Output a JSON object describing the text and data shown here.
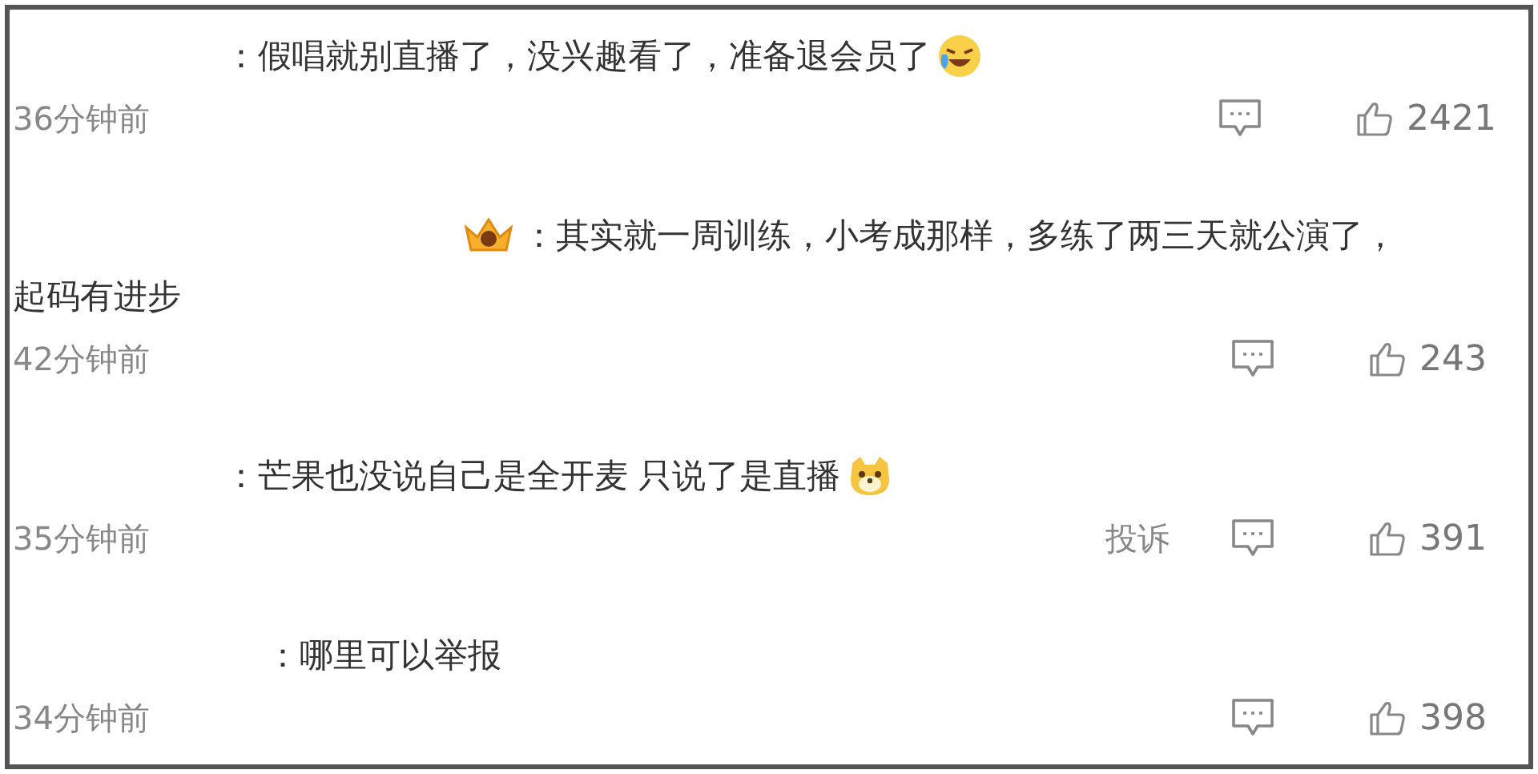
{
  "comments": [
    {
      "lines": [
        "：假唱就别直播了，没兴趣看了，准备退会员了"
      ],
      "badge": false,
      "emoji": {
        "kind": "laughing"
      },
      "time": "36分钟前",
      "likes": "2421"
    },
    {
      "lines": [
        "：其实就一周训练，小考成那样，多练了两三天就公演了，",
        "起码有进步"
      ],
      "badge": true,
      "time": "42分钟前",
      "likes": "243"
    },
    {
      "lines": [
        "：芒果也没说自己是全开麦 只说了是直播"
      ],
      "badge": false,
      "emoji": {
        "kind": "doge"
      },
      "time": "35分钟前",
      "report": "投诉",
      "likes": "391"
    },
    {
      "lines": [
        "：哪里可以举报"
      ],
      "badge": false,
      "time": "34分钟前",
      "likes": "398"
    }
  ]
}
